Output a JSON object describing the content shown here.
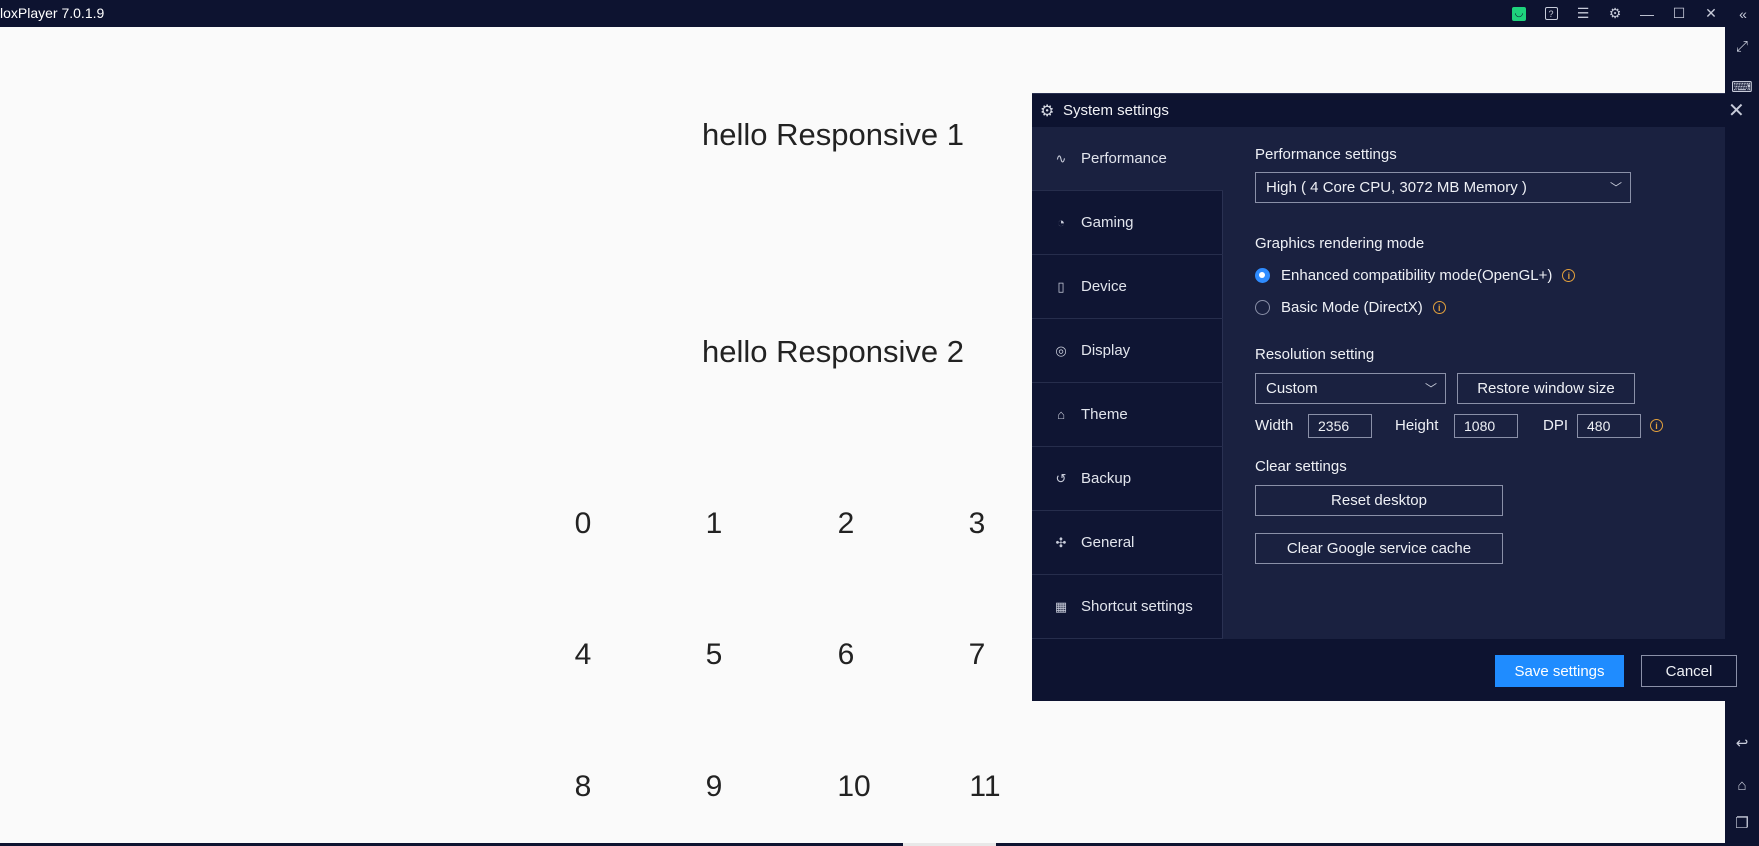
{
  "window": {
    "title": "loxPlayer 7.0.1.9"
  },
  "titlebar_icons": [
    "store-icon",
    "help-icon",
    "menu-icon",
    "settings-icon",
    "minimize-icon",
    "maximize-icon",
    "close-icon",
    "collapse-icon"
  ],
  "android": {
    "hello1": "hello Responsive 1",
    "hello2": "hello Responsive 2",
    "grid": [
      "0",
      "1",
      "2",
      "3",
      "4",
      "5",
      "6",
      "7",
      "8",
      "9",
      "10",
      "11"
    ]
  },
  "dialog": {
    "title": "System settings",
    "sidebar": [
      {
        "label": "Performance",
        "icon": "pulse-icon",
        "glyph": "∿"
      },
      {
        "label": "Gaming",
        "icon": "gamepad-icon",
        "glyph": "◔"
      },
      {
        "label": "Device",
        "icon": "device-icon",
        "glyph": "▯"
      },
      {
        "label": "Display",
        "icon": "display-icon",
        "glyph": "◎"
      },
      {
        "label": "Theme",
        "icon": "shirt-icon",
        "glyph": "⌂"
      },
      {
        "label": "Backup",
        "icon": "history-icon",
        "glyph": "↺"
      },
      {
        "label": "General",
        "icon": "puzzle-icon",
        "glyph": "✣"
      },
      {
        "label": "Shortcut settings",
        "icon": "keyboard-icon",
        "glyph": "▦"
      }
    ],
    "performance": {
      "section_title": "Performance settings",
      "selected": "High ( 4 Core CPU, 3072 MB Memory )"
    },
    "graphics": {
      "section_title": "Graphics rendering mode",
      "option1": "Enhanced compatibility mode(OpenGL+)",
      "option2": "Basic Mode (DirectX)",
      "selected_index": 0
    },
    "resolution": {
      "section_title": "Resolution setting",
      "selected": "Custom",
      "restore_label": "Restore window size",
      "width_label": "Width",
      "width_value": "2356",
      "height_label": "Height",
      "height_value": "1080",
      "dpi_label": "DPI",
      "dpi_value": "480"
    },
    "clear": {
      "section_title": "Clear settings",
      "reset_label": "Reset desktop",
      "cache_label": "Clear Google service cache"
    },
    "footer": {
      "save_label": "Save settings",
      "cancel_label": "Cancel"
    }
  },
  "colors": {
    "titlebar_bg": "#0d1330",
    "dialog_bg": "#1a2140",
    "accent": "#1f8cff",
    "info": "#e2a03c"
  }
}
